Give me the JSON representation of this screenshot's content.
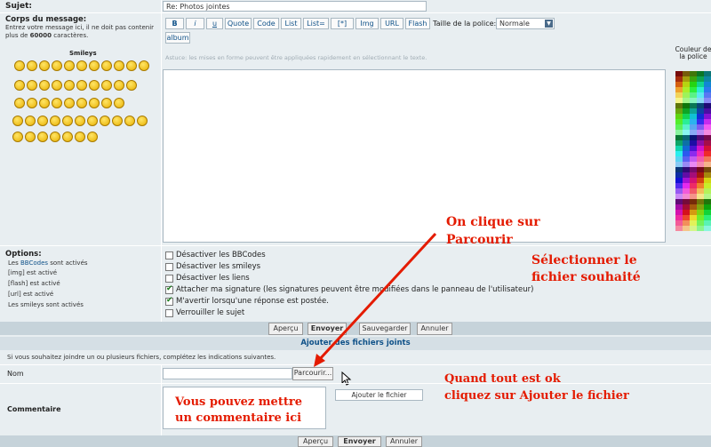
{
  "subject": {
    "label": "Sujet:",
    "value": "Re: Photos jointes"
  },
  "body": {
    "label": "Corps du message:",
    "hint": "Entrez votre message ici, il ne doit pas contenir plus de ",
    "max": "60000",
    "hint_end": " caractères.",
    "smileys_title": "Smileys",
    "helper": "Astuce: les mises en forme peuvent être appliquées rapidement en sélectionnant le texte."
  },
  "toolbar": {
    "b": "B",
    "i": "i",
    "u": "u",
    "quote": "Quote",
    "code": "Code",
    "list": "List",
    "listeq": "List=",
    "star": "[*]",
    "img": "Img",
    "url": "URL",
    "flash": "Flash",
    "album": "album",
    "size_label": "Taille de la police:",
    "size_value": "Normale"
  },
  "colors": {
    "title": "Couleur de la police"
  },
  "options": {
    "label": "Options:",
    "status": {
      "bbcode_pre": "Les ",
      "bbcode_link": "BBCodes",
      "bbcode_post": " sont activés",
      "img": "[img] est activé",
      "flash": "[flash] est activé",
      "url": "[url] est activé",
      "smileys": "Les smileys sont activés"
    },
    "items": [
      {
        "label": "Désactiver les BBCodes",
        "checked": false
      },
      {
        "label": "Désactiver les smileys",
        "checked": false
      },
      {
        "label": "Désactiver les liens",
        "checked": false
      },
      {
        "label": "Attacher ma signature (les signatures peuvent être modifiées dans le panneau de l'utilisateur)",
        "checked": true
      },
      {
        "label": "M'avertir lorsqu'une réponse est postée.",
        "checked": true
      },
      {
        "label": "Verrouiller le sujet",
        "checked": false
      }
    ]
  },
  "actions": {
    "preview": "Aperçu",
    "send": "Envoyer",
    "save": "Sauvegarder",
    "cancel": "Annuler"
  },
  "attach": {
    "title": "Ajouter des fichiers joints",
    "hint": "Si vous souhaitez joindre un ou plusieurs fichiers, complétez les indications suivantes.",
    "name_label": "Nom",
    "browse": "Parcourir...",
    "comment_label": "Commentaire",
    "add_file": "Ajouter le fichier"
  },
  "bottom": {
    "preview": "Aperçu",
    "send": "Envoyer",
    "cancel": "Annuler"
  },
  "annotations": {
    "a1": "On clique sur",
    "a2": "Parcourir",
    "a3": "Sélectionner le",
    "a4": "fichier souhaité",
    "a5": "Quand tout est ok",
    "a6": "cliquez sur Ajouter le fichier",
    "a7": "Vous pouvez mettre",
    "a8": "un commentaire ici"
  },
  "accent": "#e41b00"
}
